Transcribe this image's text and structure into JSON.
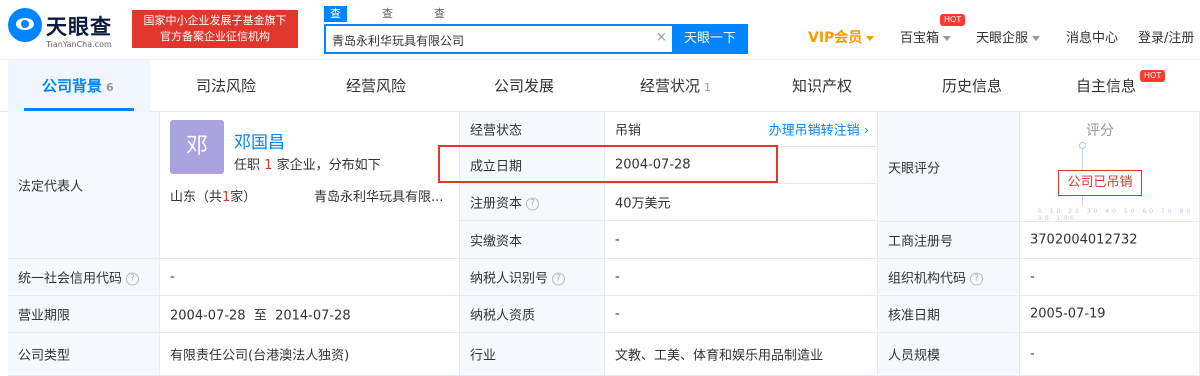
{
  "header": {
    "logo_name": "天眼查",
    "logo_domain": "TianYanCha.com",
    "badge_line1": "国家中小企业发展子基金旗下",
    "badge_line2": "官方备案企业征信机构",
    "search_tabs": [
      "查公司",
      "查老板",
      "查关系"
    ],
    "search_value": "青岛永利华玩具有限公司",
    "search_button": "天眼一下",
    "nav": {
      "vip": "VIP会员",
      "baibao": "百宝箱",
      "qiban": "天眼企服",
      "messages": "消息中心",
      "login": "登录/注册",
      "hot": "HOT"
    }
  },
  "tabs": [
    {
      "label": "公司背景",
      "count": "6"
    },
    {
      "label": "司法风险",
      "count": ""
    },
    {
      "label": "经营风险",
      "count": ""
    },
    {
      "label": "公司发展",
      "count": ""
    },
    {
      "label": "经营状况",
      "count": "1"
    },
    {
      "label": "知识产权",
      "count": ""
    },
    {
      "label": "历史信息",
      "count": ""
    },
    {
      "label": "自主信息",
      "count": ""
    }
  ],
  "info": {
    "legal_rep_label": "法定代表人",
    "rep_avatar": "邓",
    "rep_name": "邓国昌",
    "rep_desc_pre": "任职",
    "rep_desc_num": "1",
    "rep_desc_post": "家企业，分布如下",
    "rep_region_pre": "山东（共",
    "rep_region_num": "1",
    "rep_region_post": "家）",
    "rep_company": "青岛永利华玩具有限...",
    "status_label": "经营状态",
    "status_value": "吊销",
    "status_link": "办理吊销转注销",
    "founded_label": "成立日期",
    "founded_value": "2004-07-28",
    "capital_label": "注册资本",
    "capital_value": "40万美元",
    "paid_label": "实缴资本",
    "paid_value": "-",
    "tianyan_label": "天眼评分",
    "score_title": "评分",
    "score_stamp": "公司已吊销",
    "score_axis": "0 10 20 30 40 50 60 70 80 90 100",
    "reg_no_label": "工商注册号",
    "reg_no_value": "3702004012732",
    "credit_label": "统一社会信用代码",
    "credit_value": "-",
    "taxid_label": "纳税人识别号",
    "taxid_value": "-",
    "org_label": "组织机构代码",
    "org_value": "-",
    "term_label": "营业期限",
    "term_value": "2004-07-28  至  2014-07-28",
    "taxpayer_label": "纳税人资质",
    "taxpayer_value": "-",
    "approve_label": "核准日期",
    "approve_value": "2005-07-19",
    "type_label": "公司类型",
    "type_value": "有限责任公司(台港澳法人独资)",
    "industry_label": "行业",
    "industry_value": "文教、工美、体育和娱乐用品制造业",
    "staff_label": "人员规模",
    "staff_value": "-"
  }
}
